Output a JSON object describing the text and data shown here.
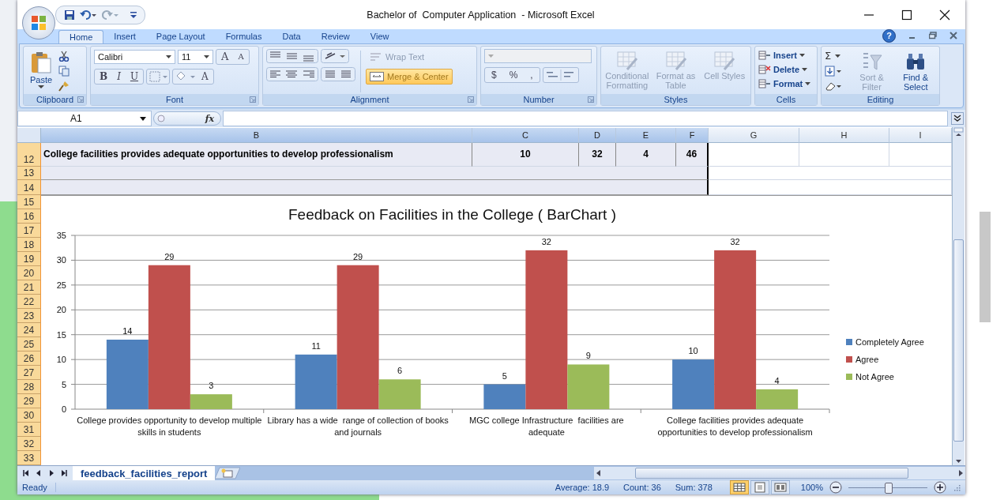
{
  "window": {
    "title": "Bachelor of  Computer Application  - Microsoft Excel"
  },
  "ribbon": {
    "help": "?",
    "tabs": [
      {
        "label": "Home",
        "selected": true
      },
      {
        "label": "Insert",
        "selected": false
      },
      {
        "label": "Page Layout",
        "selected": false
      },
      {
        "label": "Formulas",
        "selected": false
      },
      {
        "label": "Data",
        "selected": false
      },
      {
        "label": "Review",
        "selected": false
      },
      {
        "label": "View",
        "selected": false
      }
    ],
    "clipboard": {
      "label": "Clipboard",
      "paste": "Paste"
    },
    "font": {
      "label": "Font",
      "family": "Calibri",
      "size": "11",
      "grow": "A",
      "shrink": "A",
      "bold": "B",
      "italic": "I",
      "underline": "U",
      "font_color": "A"
    },
    "alignment": {
      "label": "Alignment",
      "wrap_text": {
        "label": "Wrap Text",
        "disabled": true
      },
      "merge_center": {
        "label": "Merge & Center",
        "highlighted": true
      }
    },
    "number": {
      "label": "Number",
      "currency": "$",
      "percent": "%",
      "comma": ","
    },
    "styles": {
      "label": "Styles",
      "buttons": [
        {
          "label": "Conditional Formatting",
          "disabled": true
        },
        {
          "label": "Format as Table",
          "disabled": true
        },
        {
          "label": "Cell Styles",
          "disabled": true
        }
      ]
    },
    "cells": {
      "label": "Cells",
      "buttons": [
        {
          "label": "Insert"
        },
        {
          "label": "Delete"
        },
        {
          "label": "Format"
        }
      ]
    },
    "editing": {
      "label": "Editing",
      "autosum": "Σ",
      "buttons": [
        {
          "label": "Sort & Filter",
          "disabled": true
        },
        {
          "label": "Find & Select",
          "disabled": false
        }
      ]
    }
  },
  "formula_bar": {
    "name_box": "A1",
    "function_label": "fx"
  },
  "sheet": {
    "columns": [
      {
        "label": "B",
        "selected": true
      },
      {
        "label": "C",
        "selected": true
      },
      {
        "label": "D",
        "selected": true
      },
      {
        "label": "E",
        "selected": true
      },
      {
        "label": "F",
        "selected": true
      },
      {
        "label": "G",
        "selected": false
      },
      {
        "label": "H",
        "selected": false
      },
      {
        "label": "I",
        "selected": false
      }
    ],
    "rows": [
      {
        "number": "12",
        "selected": true,
        "cells": [
          "College facilities provides adequate opportunities to develop professionalism",
          "10",
          "32",
          "4",
          "46"
        ]
      },
      {
        "number": "13",
        "selected": true
      },
      {
        "number": "14",
        "selected": true
      }
    ],
    "chart_rows": [
      {
        "number": "15",
        "selected": true
      },
      {
        "number": "16",
        "selected": true
      },
      {
        "number": "17",
        "selected": true
      },
      {
        "number": "18",
        "selected": true
      },
      {
        "number": "19",
        "selected": true
      },
      {
        "number": "20",
        "selected": true
      },
      {
        "number": "21",
        "selected": true
      },
      {
        "number": "22",
        "selected": true
      },
      {
        "number": "23",
        "selected": true
      },
      {
        "number": "24",
        "selected": true
      },
      {
        "number": "25",
        "selected": true
      },
      {
        "number": "26",
        "selected": true
      },
      {
        "number": "27",
        "selected": true
      },
      {
        "number": "28",
        "selected": true
      },
      {
        "number": "29",
        "selected": true
      },
      {
        "number": "30",
        "selected": true
      },
      {
        "number": "31",
        "selected": true
      },
      {
        "number": "32",
        "selected": true
      },
      {
        "number": "33",
        "selected": true
      }
    ],
    "chart_data": {
      "type": "bar",
      "title": "Feedback on Facilities in the College ( BarChart )",
      "categories": [
        "College provides opportunity to develop multiple skills in students",
        "Library has a wide  range of collection of books and journals",
        "MGC college Infrastructure  facilities are adequate",
        "College facilities provides adequate opportunities to develop professionalism"
      ],
      "series": [
        {
          "name": "Completely Agree",
          "color": "#4f81bd",
          "values": [
            14,
            11,
            5,
            10
          ]
        },
        {
          "name": "Agree",
          "color": "#c0504d",
          "values": [
            29,
            29,
            32,
            32
          ]
        },
        {
          "name": "Not Agree",
          "color": "#9bbb59",
          "values": [
            3,
            6,
            9,
            4
          ]
        }
      ],
      "ylim": [
        0,
        35
      ],
      "yticks": [
        0,
        5,
        10,
        15,
        20,
        25,
        30,
        35
      ],
      "data_labels": true,
      "grid": true,
      "legend": "right"
    }
  },
  "sheet_tabs": [
    {
      "label": "feedback_facilities_report",
      "selected": true
    }
  ],
  "status_bar": {
    "state": "Ready",
    "stats": [
      "Average: 18.9",
      "Count: 36",
      "Sum: 378"
    ],
    "views": [
      {
        "kind": "normal",
        "selected": true
      },
      {
        "kind": "page-layout",
        "selected": false
      },
      {
        "kind": "page-break",
        "selected": false
      }
    ],
    "zoom": "100%",
    "zoom_slider": {
      "level": 0.5
    }
  }
}
